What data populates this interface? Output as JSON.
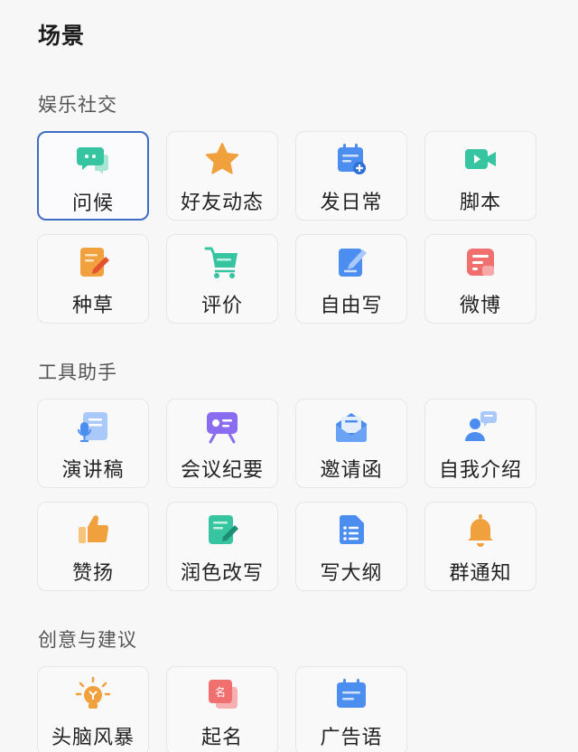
{
  "page": {
    "title": "场景"
  },
  "sections": [
    {
      "title": "娱乐社交",
      "items": [
        {
          "label": "问候",
          "icon": "chat-bubble-icon"
        },
        {
          "label": "好友动态",
          "icon": "star-icon"
        },
        {
          "label": "发日常",
          "icon": "calendar-add-icon"
        },
        {
          "label": "脚本",
          "icon": "video-camera-icon"
        },
        {
          "label": "种草",
          "icon": "note-pencil-icon"
        },
        {
          "label": "评价",
          "icon": "shopping-cart-icon"
        },
        {
          "label": "自由写",
          "icon": "pen-paper-icon"
        },
        {
          "label": "微博",
          "icon": "document-lines-icon"
        }
      ]
    },
    {
      "title": "工具助手",
      "items": [
        {
          "label": "演讲稿",
          "icon": "microphone-script-icon"
        },
        {
          "label": "会议纪要",
          "icon": "meeting-board-icon"
        },
        {
          "label": "邀请函",
          "icon": "envelope-open-icon"
        },
        {
          "label": "自我介绍",
          "icon": "person-speech-icon"
        },
        {
          "label": "赞扬",
          "icon": "thumbs-up-icon"
        },
        {
          "label": "润色改写",
          "icon": "edit-document-icon"
        },
        {
          "label": "写大纲",
          "icon": "outline-list-icon"
        },
        {
          "label": "群通知",
          "icon": "bell-icon"
        }
      ]
    },
    {
      "title": "创意与建议",
      "items": [
        {
          "label": "头脑风暴",
          "icon": "lightbulb-icon"
        },
        {
          "label": "起名",
          "icon": "name-tag-icon",
          "glyph": "名"
        },
        {
          "label": "广告语",
          "icon": "calendar-list-icon"
        }
      ]
    }
  ],
  "colors": {
    "selected_border": "#3f6cc4",
    "green": "#37c4a0",
    "orange": "#f0a03c",
    "blue": "#4b8ef0",
    "red": "#f07070",
    "purple": "#8a6cf0"
  }
}
